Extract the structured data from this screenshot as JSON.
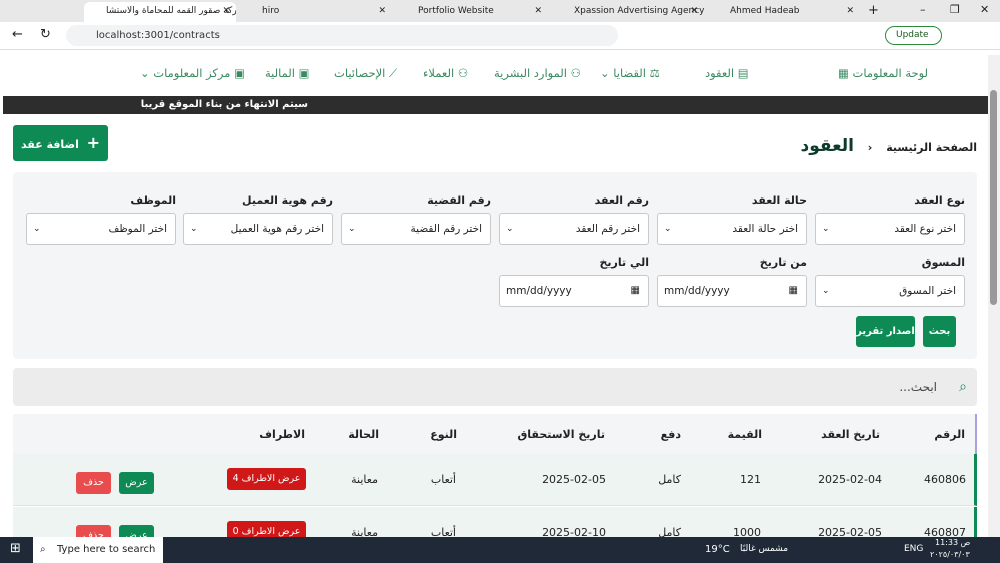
{
  "browser": {
    "tabs": [
      {
        "label": "شركة صقور القمه للمحاماة والاستشا",
        "active": true
      },
      {
        "label": "hiro"
      },
      {
        "label": "Portfolio Website"
      },
      {
        "label": "Xpassion Advertising Agency"
      },
      {
        "label": "Ahmed Hadeab"
      }
    ],
    "url": "localhost:3001/contracts",
    "update_label": "Update"
  },
  "nav": {
    "items": [
      "لوحة المعلومات",
      "العقود",
      "القضايا",
      "الموارد البشرية",
      "العملاء",
      "الإحصائيات",
      "المالية",
      "مركز المعلومات"
    ]
  },
  "banner": "سيتم الانتهاء من بناء الموقع قريبا",
  "breadcrumb": {
    "home": "الصفحة الرئيسية",
    "current": "العقود"
  },
  "add_button": "اضافة عقد",
  "filters": {
    "row1": [
      {
        "label": "نوع العقد",
        "value": "اختر نوع العقد"
      },
      {
        "label": "حالة العقد",
        "value": "اختر حالة العقد"
      },
      {
        "label": "رقم العقد",
        "value": "اختر رقم العقد"
      },
      {
        "label": "رقم القضية",
        "value": "اختر رقم القضية"
      },
      {
        "label": "رقم هوية العميل",
        "value": "اختر رقم هوية العميل"
      },
      {
        "label": "الموظف",
        "value": "اختر الموظف"
      }
    ],
    "marketer": {
      "label": "المسوق",
      "value": "اختر المسوق"
    },
    "from": {
      "label": "من تاريخ",
      "value": "mm/dd/yyyy"
    },
    "to": {
      "label": "الي تاريخ",
      "value": "mm/dd/yyyy"
    },
    "search_button": "بحث",
    "report_button": "اصدار تقرير"
  },
  "search": {
    "placeholder": "ابحث..."
  },
  "table": {
    "headers": [
      "الرقم",
      "تاريخ العقد",
      "القيمة",
      "دفع",
      "تاريخ الاستحقاق",
      "النوع",
      "الحالة",
      "الاطراف"
    ],
    "rows": [
      {
        "id": "460806",
        "date": "2025-02-04",
        "value": "121",
        "pay": "كامل",
        "due": "2025-02-05",
        "type": "أتعاب",
        "status": "معاينة",
        "parties": "عرض الاطراف 4"
      },
      {
        "id": "460807",
        "date": "2025-02-05",
        "value": "1000",
        "pay": "كامل",
        "due": "2025-02-10",
        "type": "أتعاب",
        "status": "معاينة",
        "parties": "عرض الاطراف 0"
      }
    ],
    "view": "عرض",
    "delete": "حذف"
  },
  "taskbar": {
    "search": "Type here to search",
    "weather": "19°C",
    "weather_text": "مشمس غالبًا",
    "lang": "ENG",
    "time": "11:33 ص",
    "date": "٢٠٢٥/٠٣/٠٣"
  }
}
